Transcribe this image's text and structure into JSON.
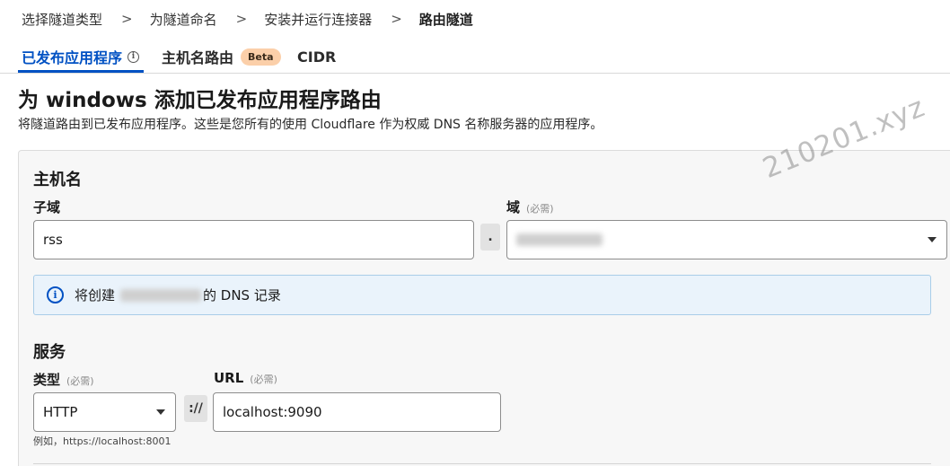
{
  "breadcrumb": {
    "items": [
      "选择隧道类型",
      "为隧道命名",
      "安装并运行连接器",
      "路由隧道"
    ],
    "separator": ">"
  },
  "tabs": {
    "items": [
      {
        "label": "已发布应用程序",
        "active": true
      },
      {
        "label": "主机名路由",
        "badge": "Beta"
      },
      {
        "label": "CIDR"
      }
    ],
    "info_glyph": "i"
  },
  "page": {
    "title": "为 windows 添加已发布应用程序路由",
    "description": "将隧道路由到已发布应用程序。这些是您所有的使用 Cloudflare 作为权威 DNS 名称服务器的应用程序。"
  },
  "hostname": {
    "section_title": "主机名",
    "subdomain_label": "子域",
    "subdomain_value": "rss",
    "dot": ".",
    "domain_label": "域",
    "domain_required": "(必需)",
    "info_prefix": "将创建",
    "info_suffix": "的 DNS 记录",
    "info_glyph": "i"
  },
  "service": {
    "section_title": "服务",
    "type_label": "类型",
    "type_required": "(必需)",
    "type_value": "HTTP",
    "protocol_sep": "://",
    "url_label": "URL",
    "url_required": "(必需)",
    "url_value": "localhost:9090",
    "helper": "例如，https://localhost:8001"
  },
  "watermark": "210201.xyz",
  "colors": {
    "accent": "#0051c3",
    "badge_bg": "#fbcfa9",
    "info_bg": "#eaf3fb",
    "info_border": "#a9cde8"
  }
}
